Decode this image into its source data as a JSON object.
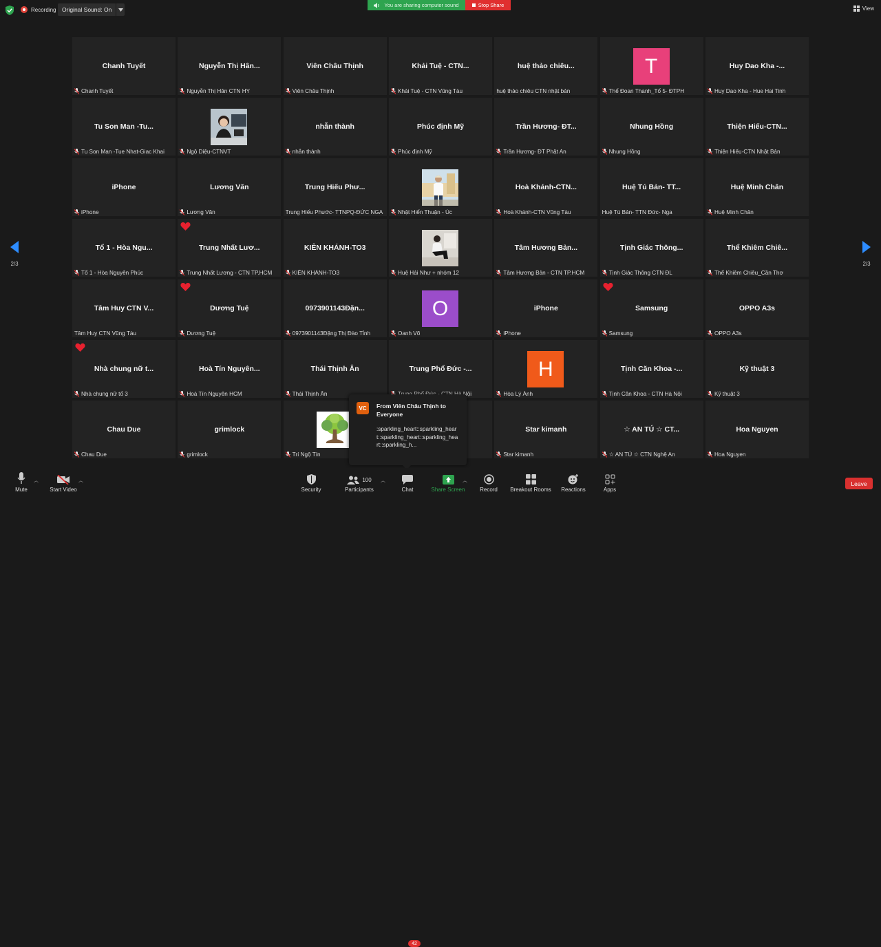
{
  "top": {
    "recording_label": "Recording",
    "original_sound": "Original Sound: On",
    "sharing_text": "You are sharing computer sound",
    "stop_share": "Stop Share",
    "view_label": "View"
  },
  "navigation": {
    "page_left": "2/3",
    "page_right": "2/3"
  },
  "tiles": [
    {
      "name": "Chanh Tuyết",
      "label": "Chanh Tuyết",
      "muted": true
    },
    {
      "name": "Nguyễn Thị Hân...",
      "label": "Nguyễn Thị Hân CTN HY",
      "muted": true
    },
    {
      "name": "Viên Châu Thịnh",
      "label": "Viên Châu Thịnh",
      "muted": true
    },
    {
      "name": "Khải Tuệ - CTN...",
      "label": "Khải Tuệ - CTN Vũng Tàu",
      "muted": true
    },
    {
      "name": "huệ thảo chiêu...",
      "label": "huệ thảo chiêu CTN nhật bản",
      "muted": false
    },
    {
      "name": "",
      "label": "Thể Đoan Thanh_Tổ 5- ĐTPH",
      "muted": true,
      "avatar": "T",
      "avatar_color": "#e8407a"
    },
    {
      "name": "Huy Dao Kha -...",
      "label": "Huy Dao Kha - Hue Hai Tinh",
      "muted": true
    },
    {
      "name": "Tu Son Man -Tu...",
      "label": "Tu Son Man -Tue Nhat-Giac Khai",
      "muted": true
    },
    {
      "name": "",
      "label": "Ngộ Diệu-CTNVT",
      "muted": true,
      "photo": "woman"
    },
    {
      "name": "nhẫn thành",
      "label": "nhẫn thành",
      "muted": true
    },
    {
      "name": "Phúc định Mỹ",
      "label": "Phúc định Mỹ",
      "muted": true
    },
    {
      "name": "Trần Hương- ĐT...",
      "label": "Trần Hương- ĐT Phật An",
      "muted": true
    },
    {
      "name": "Nhung Hồng",
      "label": "Nhung Hồng",
      "muted": true
    },
    {
      "name": "Thiện Hiếu-CTN...",
      "label": "Thiện Hiếu-CTN Nhật Bản",
      "muted": true
    },
    {
      "name": "iPhone",
      "label": "iPhone",
      "muted": true
    },
    {
      "name": "Lương Văn",
      "label": "Lương Văn",
      "muted": true
    },
    {
      "name": "Trung Hiếu Phư...",
      "label": "Trung Hiếu Phước- TTNPQ-ĐỨC NGA",
      "muted": false
    },
    {
      "name": "",
      "label": "Nhật Hiển Thuận - Úc",
      "muted": true,
      "photo": "man-stand"
    },
    {
      "name": "Hoà Khánh-CTN...",
      "label": "Hoà Khánh-CTN Vũng Tàu",
      "muted": true
    },
    {
      "name": "Huệ Tú Bản- TT...",
      "label": "Huệ Tú Bản- TTN Đức- Nga",
      "muted": false
    },
    {
      "name": "Huệ Minh Chân",
      "label": "Huệ Minh Chân",
      "muted": true
    },
    {
      "name": "Tổ 1 - Hòa Ngu...",
      "label": "Tổ 1 - Hòa Nguyên Phúc",
      "muted": true
    },
    {
      "name": "Trung Nhất Lươ...",
      "label": "Trung Nhất Lương - CTN TP.HCM",
      "muted": true,
      "heart": true
    },
    {
      "name": "KIÊN KHÁNH-TO3",
      "label": "KIÊN KHÁNH-TO3",
      "muted": true
    },
    {
      "name": "",
      "label": "Huệ Hải Như + nhóm 12",
      "muted": true,
      "photo": "man-sit"
    },
    {
      "name": "Tâm Hương Bản...",
      "label": "Tâm Hương Bản - CTN TP.HCM",
      "muted": true
    },
    {
      "name": "Tịnh Giác Thông...",
      "label": "Tịnh Giác Thông CTN ĐL",
      "muted": true
    },
    {
      "name": "Thể Khiêm Chiê...",
      "label": "Thể Khiêm Chiêu_Cần Thơ",
      "muted": true
    },
    {
      "name": "Tâm Huy CTN V...",
      "label": "Tâm Huy CTN Vũng Tàu",
      "muted": false
    },
    {
      "name": "Dương Tuệ",
      "label": "Dương Tuệ",
      "muted": true,
      "heart": true
    },
    {
      "name": "0973901143Đặn...",
      "label": "0973901143Đặng Thị Đào Tỉnh",
      "muted": true
    },
    {
      "name": "",
      "label": "Oanh Võ",
      "muted": true,
      "avatar": "O",
      "avatar_color": "#9b4dca"
    },
    {
      "name": "iPhone",
      "label": "iPhone",
      "muted": true
    },
    {
      "name": "Samsung",
      "label": "Samsung",
      "muted": true,
      "heart": true
    },
    {
      "name": "OPPO A3s",
      "label": "OPPO A3s",
      "muted": true
    },
    {
      "name": "Nhà chung nữ t...",
      "label": "Nhà chung nữ tổ 3",
      "muted": true,
      "heart": true
    },
    {
      "name": "Hoà Tín Nguyên...",
      "label": "Hoà Tín Nguyên HCM",
      "muted": true
    },
    {
      "name": "Thái Thịnh Ân",
      "label": "Thái Thịnh Ân",
      "muted": true
    },
    {
      "name": "Trung Phổ Đức -...",
      "label": "Trung Phổ Đức - CTN Hà Nội",
      "muted": true
    },
    {
      "name": "",
      "label": "Hòa Lý Ánh",
      "muted": true,
      "avatar": "H",
      "avatar_color": "#f05a1a"
    },
    {
      "name": "Tịnh Căn Khoa -...",
      "label": "Tịnh Căn Khoa - CTN Hà Nội",
      "muted": true
    },
    {
      "name": "Kỹ thuật 3",
      "label": "Kỹ thuật 3",
      "muted": true
    },
    {
      "name": "Chau Due",
      "label": "Chau Due",
      "muted": true
    },
    {
      "name": "grimlock",
      "label": "grimlock",
      "muted": true
    },
    {
      "name": "",
      "label": "Trí Ngộ Tín",
      "muted": true,
      "photo": "tree"
    },
    {
      "name": "",
      "label": "",
      "muted": false
    },
    {
      "name": "Star kimanh",
      "label": "Star kimanh",
      "muted": true
    },
    {
      "name": "☆ AN TÚ ☆ CT...",
      "label": "☆ AN TÚ ☆ CTN Nghệ An",
      "muted": true
    },
    {
      "name": "Hoa Nguyen",
      "label": "Hoa Nguyen",
      "muted": true
    }
  ],
  "chat_popup": {
    "initials": "VC",
    "from": "From Viên Châu Thịnh to Everyone",
    "message": ":sparkling_heart::sparkling_heart::sparkling_heart::sparkling_heart::sparkling_h..."
  },
  "toolbar": {
    "mute": "Mute",
    "start_video": "Start Video",
    "security": "Security",
    "participants": "Participants",
    "participants_count": "100",
    "chat": "Chat",
    "chat_badge": "42",
    "share_screen": "Share Screen",
    "record": "Record",
    "breakout": "Breakout Rooms",
    "reactions": "Reactions",
    "apps": "Apps",
    "leave": "Leave"
  },
  "colors": {
    "share_green": "#2ea44f",
    "stop_red": "#e02f2f",
    "leave_red": "#d9302f",
    "nav_blue": "#2d8cff"
  }
}
